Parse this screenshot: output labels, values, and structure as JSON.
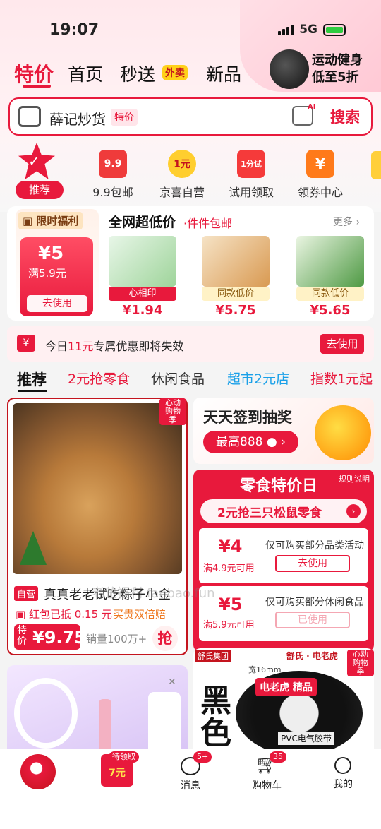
{
  "status": {
    "time": "19:07",
    "network": "5G"
  },
  "nav": {
    "tabs": [
      "特价",
      "首页",
      "秒送",
      "新品"
    ],
    "badge": "外卖",
    "promo": {
      "line1": "运动健身",
      "line2": "低至5折"
    }
  },
  "search": {
    "query": "薛记炒货",
    "tag": "特价",
    "ai": "AI",
    "button": "搜索"
  },
  "categories": [
    {
      "label": "推荐",
      "icon_text": ""
    },
    {
      "label": "9.9包邮",
      "icon_text": "9.9"
    },
    {
      "label": "京喜自营",
      "icon_text": "1元"
    },
    {
      "label": "试用领取",
      "icon_text": "1分试"
    },
    {
      "label": "领券中心",
      "icon_text": "¥"
    }
  ],
  "deal": {
    "limited": "限时福利",
    "coupon": {
      "value": "¥5",
      "condition": "满5.9元",
      "button": "去使用"
    },
    "title": "全网超低价",
    "subtitle": "·件件包邮",
    "more": "更多",
    "products": [
      {
        "tag": "心相印",
        "price": "¥1.94"
      },
      {
        "tag": "同款低价",
        "price": "¥5.75"
      },
      {
        "tag": "同款低价",
        "price": "¥5.65"
      }
    ]
  },
  "expire": {
    "icon": "¥",
    "text_prefix": "今日",
    "amount": "11元",
    "text_suffix": "专属优惠即将失效",
    "button": "去使用"
  },
  "feed_tabs": [
    "推荐",
    "2元抢零食",
    "休闲食品",
    "超市2元店",
    "指数1元起"
  ],
  "card1": {
    "badge": "心动购物季",
    "self": "自营",
    "title": "真真老老试吃粽子小金",
    "redpacket": "红包已抵 0.15 元",
    "double": "买贵双倍赔",
    "price_tag": "特价",
    "price": "¥9.75",
    "sold": "销量100万+",
    "grab": "抢"
  },
  "sign": {
    "title": "天天签到抽奖",
    "button": "最高888"
  },
  "snack": {
    "title": "零食特价日",
    "rule": "规则说明",
    "bar": "2元抢三只松鼠零食",
    "coupons": [
      {
        "value": "¥4",
        "condition": "满4.9元可用",
        "desc": "仅可购买部分品类活动",
        "button": "去使用",
        "used": false
      },
      {
        "value": "¥5",
        "condition": "满5.9元可用",
        "desc": "仅可购买部分休闲食品",
        "button": "已使用",
        "used": true
      }
    ]
  },
  "card4": {
    "brand": "舒氏集团",
    "brand2": "舒氏 · 电老虎",
    "badge": "心动购物季",
    "big": "黑色",
    "label": "电老虎 精品",
    "size": "宽16mm",
    "product": "PVC电气胶带"
  },
  "watermark": "老爸福利 fanbao.fun",
  "bottom": [
    {
      "label": "",
      "badge": ""
    },
    {
      "label": "7元",
      "badge": "待领取"
    },
    {
      "label": "消息",
      "badge": "5+"
    },
    {
      "label": "购物车",
      "badge": "35"
    },
    {
      "label": "我的",
      "badge": ""
    }
  ],
  "colors": {
    "accent": "#e8193c",
    "orange": "#ef7a22",
    "yellow": "#ffd11a"
  }
}
